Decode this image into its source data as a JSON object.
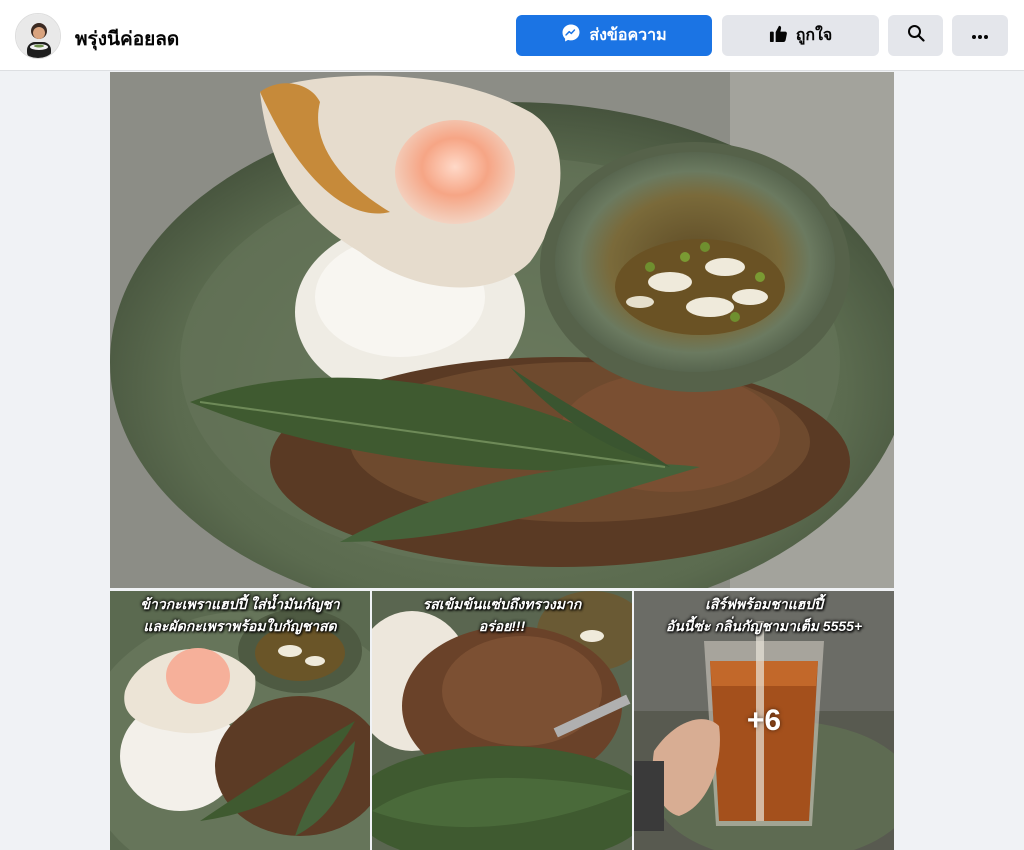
{
  "header": {
    "page_name": "พรุ่งนีค่อยลด",
    "buttons": {
      "message_label": "ส่งข้อความ",
      "like_label": "ถูกใจ"
    },
    "icons": {
      "message": "messenger-icon",
      "like": "thumbs-up-icon",
      "search": "search-icon",
      "more": "more-horizontal-icon"
    },
    "colors": {
      "primary": "#1b74e4",
      "secondary_button": "#e4e6eb"
    }
  },
  "gallery": {
    "thumbnails": [
      {
        "caption_line1": "ข้าวกะเพราแฮปปี้ ใส่น้ำมันกัญชา",
        "caption_line2": "และผัดกะเพราพร้อมใบกัญชาสด"
      },
      {
        "caption_line1": "รสเข้มข้นแซ่บถึงทรวงมาก",
        "caption_line2": "อร่อย!!!"
      },
      {
        "caption_line1": "เสิร์ฟพร้อมชาแฮปปี้",
        "caption_line2": "อันนี้ซ่ะ กลิ่นกัญชามาเต็ม 5555+",
        "more_count": "+6"
      }
    ]
  }
}
